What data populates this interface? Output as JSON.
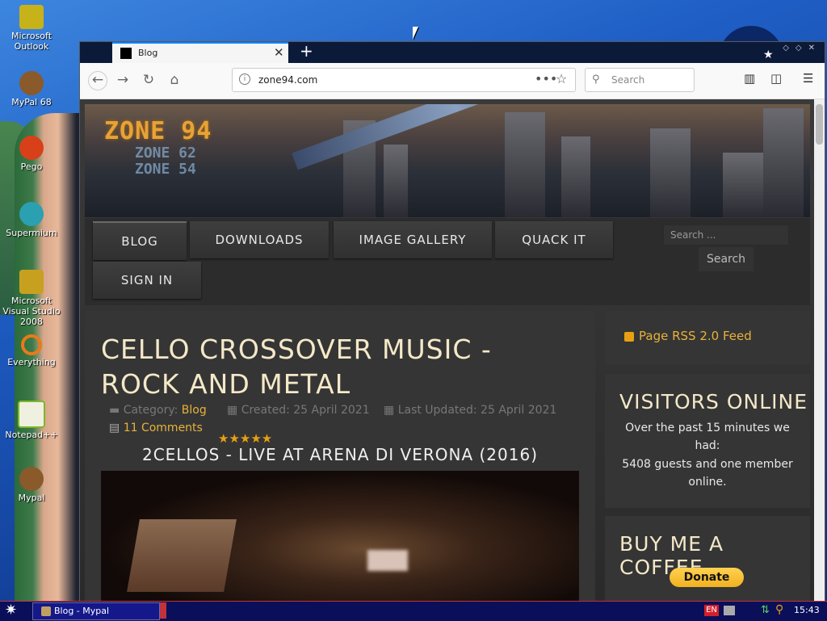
{
  "desktop": {
    "icons": [
      {
        "label": "Microsoft Outlook",
        "color": "#c8b21a"
      },
      {
        "label": "MyPal 68",
        "color": "#8a5a2a"
      },
      {
        "label": "Pego",
        "color": "#d8401a"
      },
      {
        "label": "Supermium",
        "color": "#2aa0b0"
      },
      {
        "label": "Microsoft Visual Studio 2008",
        "color": "#c8a020"
      },
      {
        "label": "Everything",
        "color": "#e87a1a"
      },
      {
        "label": "Notepad++",
        "color": "#7ab82a"
      },
      {
        "label": "Mypal",
        "color": "#8a5a2a"
      }
    ]
  },
  "browser": {
    "tab_title": "Blog",
    "tab_close": "✕",
    "new_tab": "+",
    "url": "zone94.com",
    "url_actions": "•••",
    "search_placeholder": "Search",
    "accent": "#0a84ff"
  },
  "site": {
    "banner": {
      "logo": "ZONE 94",
      "sub1": "ZONE 62",
      "sub2": "ZONE 54"
    },
    "menu": [
      "BLOG",
      "DOWNLOADS",
      "IMAGE GALLERY",
      "QUACK IT",
      "SIGN IN"
    ],
    "search_placeholder": "Search ...",
    "search_button": "Search",
    "article": {
      "title": "CELLO CROSSOVER MUSIC - ROCK AND METAL",
      "category_label": "Category: ",
      "category": "Blog",
      "created": "Created: 25 April 2021",
      "updated": "Last Updated: 25 April 2021",
      "comments": "11 Comments",
      "rating_stars": "★★★★★",
      "video_title": "2CELLOS - LIVE AT ARENA DI VERONA (2016)"
    },
    "sidebar": {
      "rss": "Page RSS 2.0 Feed",
      "visitors_heading": "VISITORS ONLINE",
      "visitors_text1": "Over the past 15 minutes we had:",
      "visitors_text2": "5408 guests and one member online.",
      "coffee_heading": "BUY ME A COFFEE",
      "donate": "Donate"
    },
    "accent": "#e8b23a"
  },
  "taskbar": {
    "task_label": "Blog - Mypal",
    "lang": "EN",
    "clock": "15:43"
  }
}
